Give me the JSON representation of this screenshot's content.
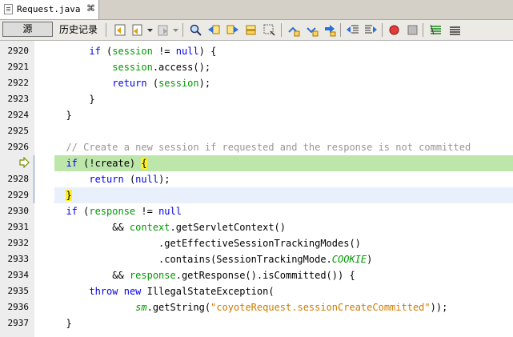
{
  "tab": {
    "label": "Request.java",
    "close": "⌘"
  },
  "toolbar": {
    "source_label": "源",
    "history_label": "历史记录"
  },
  "lines": [
    {
      "num": "2920",
      "text": "if (session != null) {"
    },
    {
      "num": "2921",
      "text": "session.access();"
    },
    {
      "num": "2922",
      "text": "return (session);"
    },
    {
      "num": "2923",
      "text": "}"
    },
    {
      "num": "2924",
      "text": "}"
    },
    {
      "num": "2925",
      "text": ""
    },
    {
      "num": "2926",
      "text": "// Create a new session if requested and the response is not committed"
    },
    {
      "num": "",
      "text": "if (!create) {"
    },
    {
      "num": "2928",
      "text": "return (null);"
    },
    {
      "num": "2929",
      "text": "}"
    },
    {
      "num": "2930",
      "text": "if (response != null"
    },
    {
      "num": "2931",
      "text": "&& context.getServletContext()"
    },
    {
      "num": "2932",
      "text": ".getEffectiveSessionTrackingModes()"
    },
    {
      "num": "2933",
      "text": ".contains(SessionTrackingMode.COOKIE)"
    },
    {
      "num": "2934",
      "text": "&& response.getResponse().isCommitted()) {"
    },
    {
      "num": "2935",
      "text": "throw new IllegalStateException("
    },
    {
      "num": "2936",
      "text": "sm.getString(\"coyoteRequest.sessionCreateCommitted\"));"
    },
    {
      "num": "2937",
      "text": "}"
    }
  ]
}
